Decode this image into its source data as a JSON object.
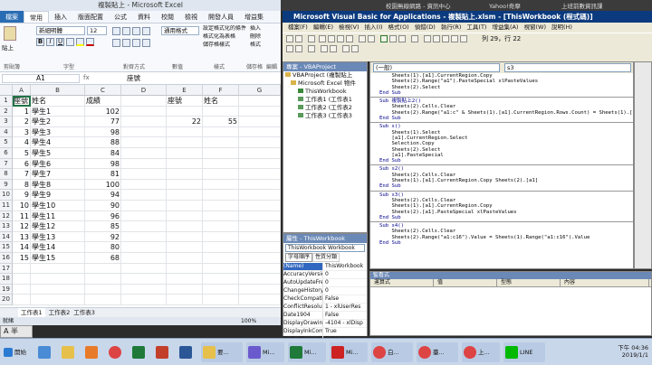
{
  "excel": {
    "title": "複製貼上 - Microsoft Excel",
    "tabs": [
      "檔案",
      "常用",
      "插入",
      "版面配置",
      "公式",
      "資料",
      "校閱",
      "檢視",
      "開發人員",
      "增益集"
    ],
    "ribbon": {
      "paste": "貼上",
      "font_name": "新細明體",
      "font_size": "12",
      "align_label": "對齊方式",
      "number_format": "通用格式",
      "number_label": "數值",
      "styles_label": "樣式",
      "cells_label": "儲存格",
      "edit_label": "編輯",
      "clipboard_label": "剪貼簿",
      "font_label": "字型",
      "cond": "設定格式化的條件",
      "as_table": "格式化為表格",
      "cell_style": "儲存格樣式",
      "insert": "插入",
      "delete": "刪除",
      "format": "格式"
    },
    "name_box": "A1",
    "formula_value": "座號",
    "columns": [
      "A",
      "B",
      "C",
      "D",
      "E",
      "F",
      "G"
    ],
    "rows": [
      [
        "座號",
        "姓名",
        "成績",
        "",
        "座號",
        "姓名",
        ""
      ],
      [
        "1",
        "學生1",
        "102",
        "",
        "",
        "",
        ""
      ],
      [
        "2",
        "學生2",
        "77",
        "",
        "22",
        "55",
        ""
      ],
      [
        "3",
        "學生3",
        "98",
        "",
        "",
        "",
        ""
      ],
      [
        "4",
        "學生4",
        "88",
        "",
        "",
        "",
        ""
      ],
      [
        "5",
        "學生5",
        "84",
        "",
        "",
        "",
        ""
      ],
      [
        "6",
        "學生6",
        "98",
        "",
        "",
        "",
        ""
      ],
      [
        "7",
        "學生7",
        "81",
        "",
        "",
        "",
        ""
      ],
      [
        "8",
        "學生8",
        "100",
        "",
        "",
        "",
        ""
      ],
      [
        "9",
        "學生9",
        "94",
        "",
        "",
        "",
        ""
      ],
      [
        "10",
        "學生10",
        "90",
        "",
        "",
        "",
        ""
      ],
      [
        "11",
        "學生11",
        "96",
        "",
        "",
        "",
        ""
      ],
      [
        "12",
        "學生12",
        "85",
        "",
        "",
        "",
        ""
      ],
      [
        "13",
        "學生13",
        "92",
        "",
        "",
        "",
        ""
      ],
      [
        "14",
        "學生14",
        "80",
        "",
        "",
        "",
        ""
      ],
      [
        "15",
        "學生15",
        "68",
        "",
        "",
        "",
        ""
      ],
      [
        "",
        "",
        "",
        "",
        "",
        "",
        ""
      ],
      [
        "",
        "",
        "",
        "",
        "",
        "",
        ""
      ],
      [
        "",
        "",
        "",
        "",
        "",
        "",
        ""
      ],
      [
        "",
        "",
        "",
        "",
        "",
        "",
        ""
      ]
    ],
    "sheet_tabs": [
      "工作表1",
      "工作表2",
      "工作表3"
    ],
    "status_ready": "就緒",
    "zoom": "100%",
    "ime": "A 半"
  },
  "behind_tabs": [
    "校園無線網路 - 資訊中心",
    "Yahoo!奇摩",
    "上班前數資訊課"
  ],
  "vba": {
    "title": "Microsoft Visual Basic for Applications - 複製貼上.xlsm - [ThisWorkbook (程式碼)]",
    "menu": [
      "檔案(F)",
      "編輯(E)",
      "檢視(V)",
      "插入(I)",
      "格式(O)",
      "偵錯(D)",
      "執行(R)",
      "工具(T)",
      "增益集(A)",
      "視窗(W)",
      "說明(H)"
    ],
    "position": "列 29，行 22",
    "project_title": "專案 - VBAProject",
    "tree": [
      "VBAProject (複製貼上",
      "Microsoft Excel 物件",
      "ThisWorkbook",
      "工作表1 (工作表1",
      "工作表2 (工作表2",
      "工作表3 (工作表3"
    ],
    "props_title": "屬性 - ThisWorkbook",
    "props_combo": "ThisWorkbook Workbook",
    "props_tabs": [
      "字母順序",
      "性質分類"
    ],
    "props": [
      [
        "(Name)",
        "ThisWorkbook"
      ],
      [
        "AccuracyVersio",
        "0"
      ],
      [
        "AutoUpdateFre",
        "0"
      ],
      [
        "ChangeHistoryD",
        "0"
      ],
      [
        "CheckCompatil",
        "False"
      ],
      [
        "ConflictResolut",
        "1 - xlUserRes"
      ],
      [
        "Date1904",
        "False"
      ],
      [
        "DisplayDrawing",
        "-4104 - xlDisp"
      ],
      [
        "DisplayInkComr",
        "True"
      ],
      [
        "DoNotPromptF",
        "False"
      ]
    ],
    "combo_left": "(一般)",
    "combo_right": "s3",
    "code": [
      "    Sheets(1).[a1].CurrentRegion.Copy",
      "    Sheets(2).Range(\"a1\").PasteSpecial xlPasteValues",
      "    Sheets(2).Select",
      "End Sub",
      "--",
      "Sub 複製貼上2()",
      "    Sheets(2).Cells.Clear",
      "    Sheets(2).Range(\"a1:c\" & Sheets(1).[a1].CurrentRegion.Rows.Count) = Sheets(1).[",
      "End Sub",
      "--",
      "Sub s()",
      "    Sheets(1).Select",
      "    [a1].CurrentRegion.Select",
      "    Selection.Copy",
      "    Sheets(2).Select",
      "    [a1].PasteSpecial",
      "End Sub",
      "--",
      "Sub s2()",
      "    Sheets(2).Cells.Clear",
      "    Sheets(1).[a1].CurrentRegion.Copy Sheets(2).[a1]",
      "End Sub",
      "--",
      "Sub s3()",
      "    Sheets(2).Cells.Clear",
      "    Sheets(1).[a1].CurrentRegion.Copy",
      "    Sheets(2).[a1].PasteSpecial xlPasteValues",
      "End Sub",
      "--",
      "Sub s4()",
      "    Sheets(2).Cells.Clear",
      "    Sheets(2).Range(\"a1:c16\").Value = Sheets(1).Range(\"a1:c16\").Value",
      "End Sub"
    ],
    "watch_title": "監看式",
    "watch_cols": [
      "運算式",
      "值",
      "型態",
      "內容"
    ]
  },
  "taskbar": {
    "start": "開始",
    "items": [
      "要...",
      "Mi...",
      "Mi...",
      "Mi...",
      "白...",
      "臺...",
      "上...",
      "LINE"
    ],
    "time": "下午 04:36",
    "date": "2019/1/1"
  }
}
